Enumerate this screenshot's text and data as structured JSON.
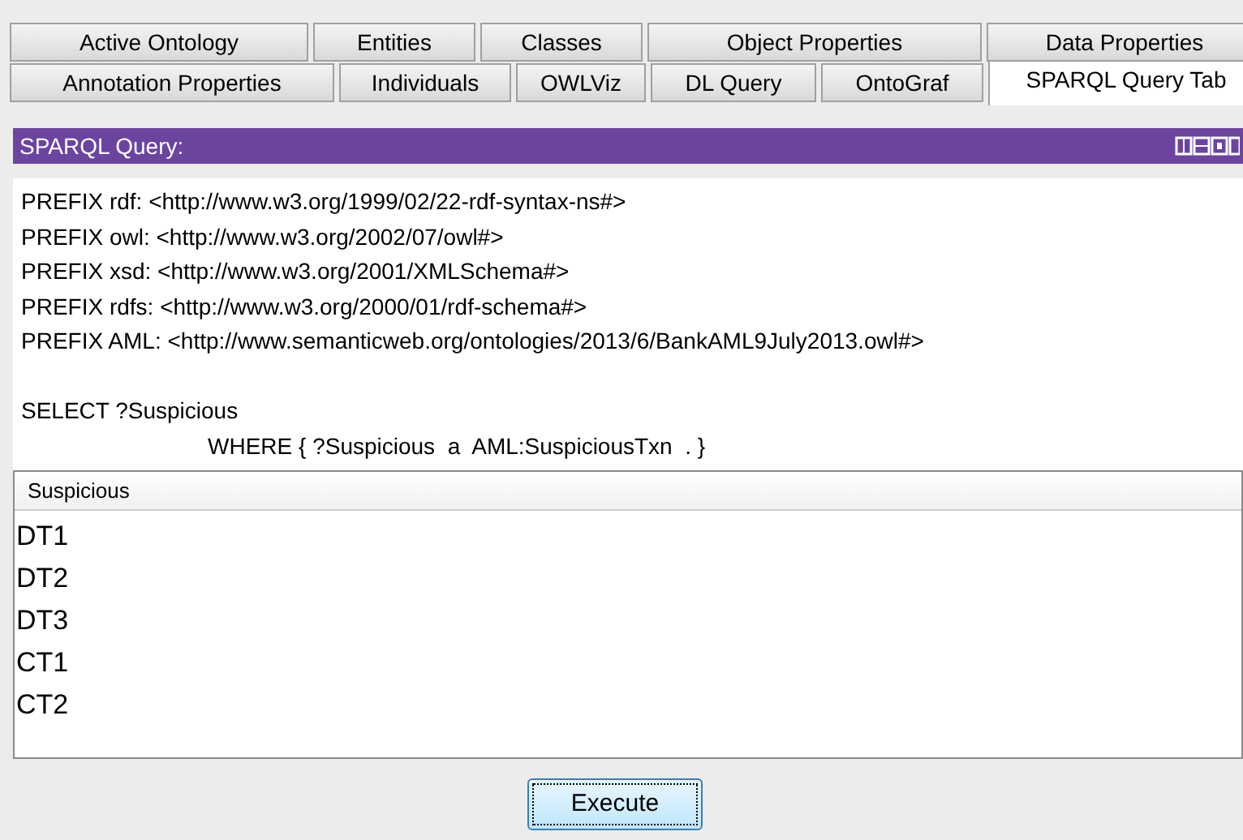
{
  "tabs_row_1": [
    {
      "label": "Active Ontology",
      "selected": false
    },
    {
      "label": "Entities",
      "selected": false
    },
    {
      "label": "Classes",
      "selected": false
    },
    {
      "label": "Object Properties",
      "selected": false
    },
    {
      "label": "Data Properties",
      "selected": false
    }
  ],
  "tabs_row_2": [
    {
      "label": "Annotation Properties",
      "selected": false
    },
    {
      "label": "Individuals",
      "selected": false
    },
    {
      "label": "OWLViz",
      "selected": false
    },
    {
      "label": "DL Query",
      "selected": false
    },
    {
      "label": "OntoGraf",
      "selected": false
    },
    {
      "label": "SPARQL Query Tab",
      "selected": true
    }
  ],
  "panel": {
    "title": "SPARQL Query:"
  },
  "query_lines": [
    {
      "kind": "line",
      "text": "PREFIX rdf: <http://www.w3.org/1999/02/22-rdf-syntax-ns#>"
    },
    {
      "kind": "line",
      "text": "PREFIX owl: <http://www.w3.org/2002/07/owl#>"
    },
    {
      "kind": "line",
      "text": "PREFIX xsd: <http://www.w3.org/2001/XMLSchema#>"
    },
    {
      "kind": "line",
      "text": "PREFIX rdfs: <http://www.w3.org/2000/01/rdf-schema#>"
    },
    {
      "kind": "line",
      "text": "PREFIX AML: <http://www.semanticweb.org/ontologies/2013/6/BankAML9July2013.owl#>"
    },
    {
      "kind": "blank"
    },
    {
      "kind": "line",
      "text": "SELECT ?Suspicious"
    },
    {
      "kind": "indented",
      "text": "WHERE { ?Suspicious  a  AML:SuspiciousTxn  . }"
    }
  ],
  "results": {
    "column": "Suspicious",
    "rows": [
      "DT1",
      "DT2",
      "DT3",
      "CT1",
      "CT2"
    ]
  },
  "execute_button": "Execute"
}
